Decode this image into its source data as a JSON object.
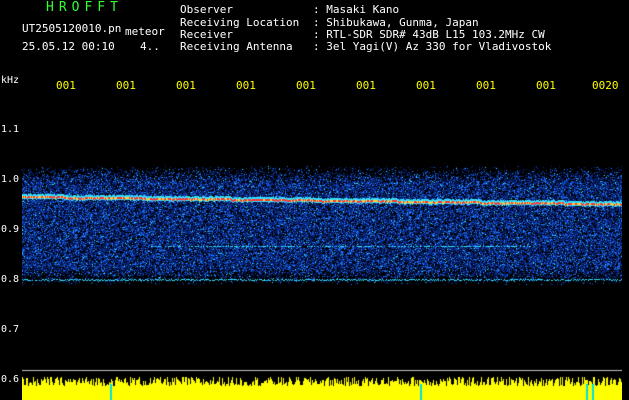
{
  "header": {
    "logo": "HROFFT",
    "filename": "UT2505120010.pn",
    "meteor_label": "meteor",
    "datetime": "25.05.12 00:10",
    "detection_count": "4..",
    "info": [
      {
        "label": "Observer",
        "value": "Masaki Kano"
      },
      {
        "label": "Receiving Location",
        "value": "Shibukawa, Gunma, Japan"
      },
      {
        "label": "Receiver",
        "value": "RTL-SDR SDR# 43dB L15 103.2MHz CW"
      },
      {
        "label": "Receiving Antenna",
        "value": "3el Yagi(V) Az 330 for Vladivostok"
      }
    ]
  },
  "chart_data": {
    "type": "heatmap",
    "ylabel": "kHz",
    "y_ticks": [
      "1.1",
      "1.0",
      "0.9",
      "0.8",
      "0.7",
      "0.6"
    ],
    "x_ticks": [
      "001",
      "001",
      "001",
      "001",
      "001",
      "001",
      "001",
      "001",
      "001",
      "0020"
    ],
    "colors": {
      "background": "#000020",
      "noise_low": "#0a2a8a",
      "noise_high": "#1e78ff",
      "carrier": "#ff3030",
      "echo": "#30e0ff",
      "amplitude": "#ffff00",
      "axis": "#ffffff",
      "tick_label": "#ffff00"
    }
  }
}
